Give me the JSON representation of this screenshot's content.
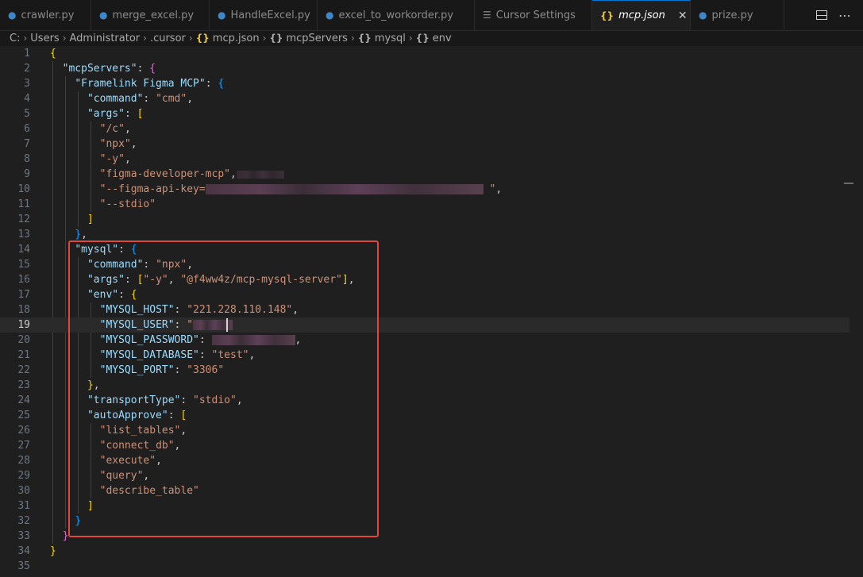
{
  "tabs": [
    {
      "label": "crawler.py",
      "icon": "python-file-icon"
    },
    {
      "label": "merge_excel.py",
      "icon": "python-file-icon"
    },
    {
      "label": "HandleExcel.py",
      "icon": "python-file-icon"
    },
    {
      "label": "excel_to_workorder.py",
      "icon": "python-file-icon"
    },
    {
      "label": "Cursor Settings",
      "icon": "settings-icon"
    },
    {
      "label": "mcp.json",
      "icon": "json-file-icon"
    },
    {
      "label": "prize.py",
      "icon": "python-file-icon"
    }
  ],
  "breadcrumb": [
    "C:",
    "Users",
    "Administrator",
    ".cursor",
    "mcp.json",
    "mcpServers",
    "mysql",
    "env"
  ],
  "current_line": "19",
  "colors": {
    "accent": "#0078d4",
    "highlight_box": "#e0483e",
    "string": "#ce9178",
    "key": "#9cdcfe"
  },
  "code": {
    "l2_key": "\"mcpServers\"",
    "l3_key": "\"Framelink Figma MCP\"",
    "l4_key": "\"command\"",
    "l4_val": "\"cmd\"",
    "l5_key": "\"args\"",
    "l6": "\"/c\"",
    "l7": "\"npx\"",
    "l8": "\"-y\"",
    "l9": "\"figma-developer-mcp\"",
    "l10": "\"--figma-api-key=",
    "l10_end": " \"",
    "l11": "\"--stdio\"",
    "l14_key": "\"mysql\"",
    "l15_key": "\"command\"",
    "l15_val": "\"npx\"",
    "l16_key": "\"args\"",
    "l16_v1": "\"-y\"",
    "l16_v2": "\"@f4ww4z/mcp-mysql-server\"",
    "l17_key": "\"env\"",
    "l18_key": "\"MYSQL_HOST\"",
    "l18_val": "\"221.228.110.148\"",
    "l19_key": "\"MYSQL_USER\"",
    "l19_val": "\"",
    "l20_key": "\"MYSQL_PASSWORD\"",
    "l21_key": "\"MYSQL_DATABASE\"",
    "l21_val": "\"test\"",
    "l22_key": "\"MYSQL_PORT\"",
    "l22_val": "\"3306\"",
    "l24_key": "\"transportType\"",
    "l24_val": "\"stdio\"",
    "l25_key": "\"autoApprove\"",
    "l26": "\"list_tables\"",
    "l27": "\"connect_db\"",
    "l28": "\"execute\"",
    "l29": "\"query\"",
    "l30": "\"describe_table\""
  }
}
